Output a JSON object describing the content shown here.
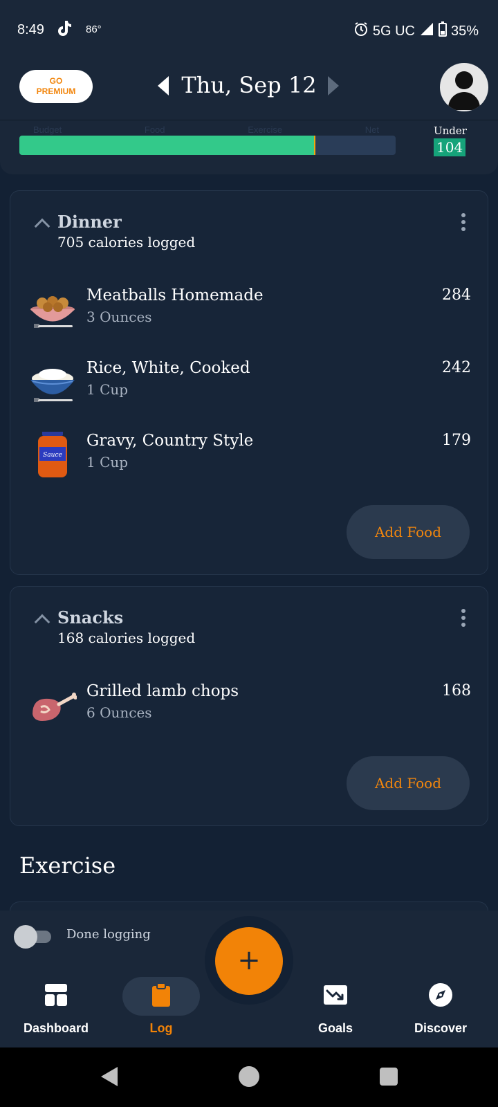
{
  "status_bar": {
    "time": "8:49",
    "temperature": "86°",
    "network": "5G UC",
    "battery": "35%"
  },
  "header": {
    "premium_label_line1": "GO",
    "premium_label_line2": "PREMIUM",
    "date": "Thu, Sep 12"
  },
  "budget": {
    "labels": [
      "Budget",
      "Food",
      "Exercise",
      "Net"
    ],
    "under_label": "Under",
    "under_value": "104",
    "progress_fraction": 0.786,
    "marker_fraction": 0.783
  },
  "meals": [
    {
      "title": "Dinner",
      "subtitle": "705 calories logged",
      "items": [
        {
          "name": "Meatballs Homemade",
          "qty": "3 Ounces",
          "cals": "284",
          "icon": "meatballs-bowl-icon"
        },
        {
          "name": "Rice, White, Cooked",
          "qty": "1 Cup",
          "cals": "242",
          "icon": "rice-bowl-icon"
        },
        {
          "name": "Gravy, Country Style",
          "qty": "1 Cup",
          "cals": "179",
          "icon": "sauce-jar-icon",
          "jar_label": "Sauce"
        }
      ],
      "add_label": "Add Food"
    },
    {
      "title": "Snacks",
      "subtitle": "168 calories logged",
      "items": [
        {
          "name": "Grilled lamb chops",
          "qty": "6 Ounces",
          "cals": "168",
          "icon": "lamb-chop-icon"
        }
      ],
      "add_label": "Add Food"
    }
  ],
  "exercise": {
    "title": "Exercise"
  },
  "done_logging": {
    "label": "Done logging",
    "checked": false
  },
  "fab": {
    "symbol": "+"
  },
  "nav": {
    "items": [
      {
        "label": "Dashboard",
        "icon": "dashboard-icon"
      },
      {
        "label": "Log",
        "icon": "clipboard-icon",
        "active": true
      },
      {
        "label": "Goals",
        "icon": "goals-chart-icon"
      },
      {
        "label": "Discover",
        "icon": "compass-icon"
      }
    ]
  },
  "colors": {
    "accent": "#f28307",
    "progress": "#33c98a",
    "under_badge": "#16a37a",
    "background": "#132134",
    "card": "#172538"
  }
}
